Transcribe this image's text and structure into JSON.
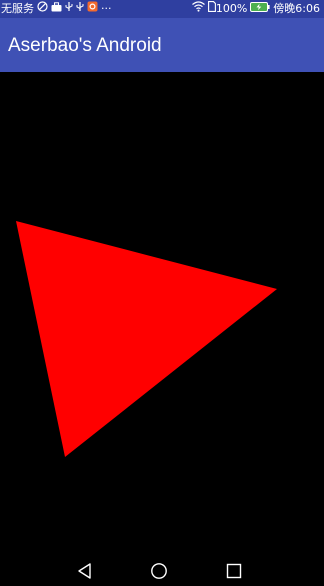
{
  "status_bar": {
    "carrier_text": "无服务",
    "battery_percent": "100%",
    "time": "傍晚6:06",
    "icons": [
      "no-signal-icon",
      "briefcase-icon",
      "usb-icon",
      "usb-debug-icon",
      "app-notification-icon",
      "more-notifications-icon",
      "wifi-icon",
      "sim-icon",
      "battery-charging-icon"
    ],
    "more_glyph": "···"
  },
  "toolbar": {
    "title": "Aserbao's Android"
  },
  "canvas": {
    "background": "#000000",
    "shape": {
      "type": "triangle",
      "color": "#ff0000"
    }
  },
  "nav_bar": {
    "buttons": [
      "back-icon",
      "home-icon",
      "recents-icon"
    ]
  },
  "colors": {
    "status_bar": "#2f3fa0",
    "toolbar": "#3f51b5",
    "triangle": "#ff0000"
  }
}
